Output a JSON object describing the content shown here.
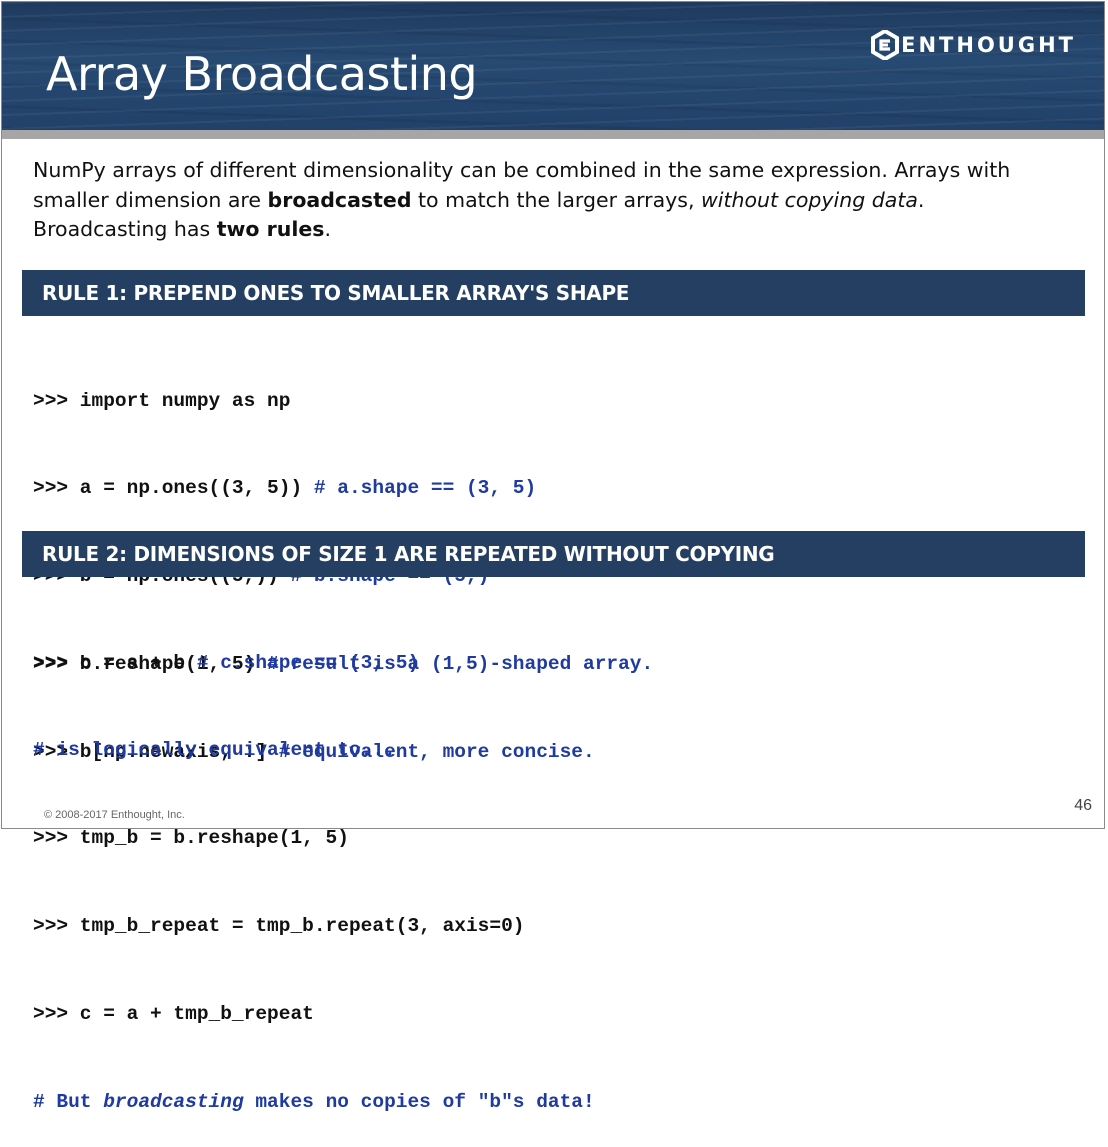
{
  "slide": {
    "title": "Array Broadcasting",
    "logo_text": "ENTHOUGHT",
    "intro": {
      "p1": "NumPy arrays of different dimensionality can be combined in the same expression.  Arrays with smaller dimension are ",
      "bold1": "broadcasted",
      "p2": " to match the larger arrays, ",
      "italic1": "without copying data",
      "p3": ".  Broadcasting has ",
      "bold2": "two rules",
      "p4": "."
    },
    "rule1": {
      "heading": "RULE 1: PREPEND ONES TO SMALLER ARRAY'S SHAPE",
      "lines": [
        {
          "code": ">>> import numpy as np",
          "comment": ""
        },
        {
          "code": ">>> a = np.ones((3, 5)) ",
          "comment": "# a.shape == (3, 5)"
        },
        {
          "code": ">>> b = np.ones((5,)) ",
          "comment": "# b.shape == (5,)"
        },
        {
          "code": ">>> b.reshape(1, 5) ",
          "comment": "# result is a (1,5)-shaped array."
        },
        {
          "code": ">>> b[np.newaxis, :] ",
          "comment": "# equivalent, more concise."
        }
      ]
    },
    "rule2": {
      "heading": "RULE 2: DIMENSIONS OF SIZE 1 ARE REPEATED WITHOUT COPYING",
      "lines": [
        {
          "code": ">>> c = a + b ",
          "comment": "# c.shape == (3, 5)"
        },
        {
          "code": "",
          "comment": "# is logically equivalent to..."
        },
        {
          "code": ">>> tmp_b = b.reshape(1, 5)",
          "comment": ""
        },
        {
          "code": ">>> tmp_b_repeat = tmp_b.repeat(3, axis=0)",
          "comment": ""
        },
        {
          "code": ">>> c = a + tmp_b_repeat",
          "comment": ""
        }
      ],
      "last_line": {
        "pre": "# But ",
        "italic": "broadcasting",
        "post": " makes no copies of \"b\"s data!"
      }
    },
    "footer": {
      "copyright": "© 2008-2017 Enthought, Inc.",
      "page_number": "46"
    },
    "colors": {
      "header_bg": "#21416a",
      "rule_bar_bg": "#243f62",
      "comment": "#1f3aa0"
    },
    "icons": {
      "logo": "enthought-logo-icon"
    }
  }
}
